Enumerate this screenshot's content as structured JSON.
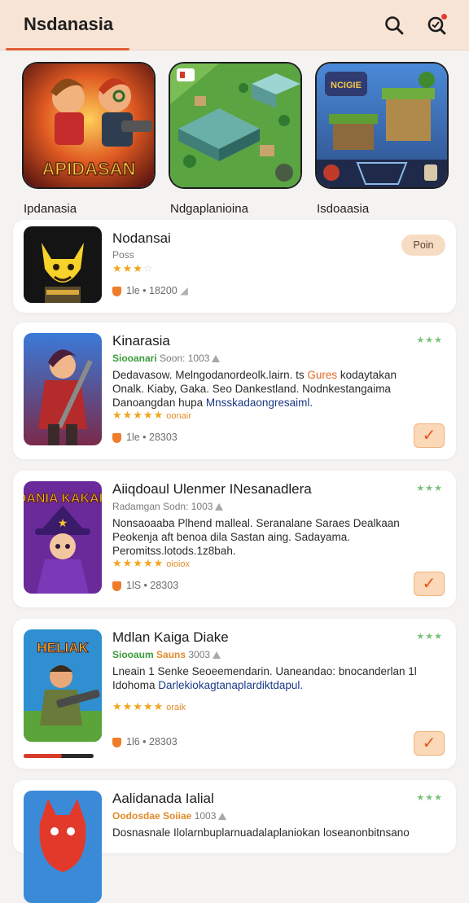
{
  "header": {
    "title": "Nsdanasia",
    "search_icon": "search-icon",
    "notif_icon": "notification-search-icon"
  },
  "featured": [
    {
      "name": "Ipdanasia",
      "art_text": "APIDASAN"
    },
    {
      "name": "Ndgaplanioina"
    },
    {
      "name": "Isdoaasia",
      "art_text": "NCIGIE"
    }
  ],
  "top_card": {
    "title": "Nodansai",
    "subtitle": "Poss",
    "stars": "★★★",
    "stars_empty": "☆",
    "stats": "1le • 18200",
    "play_label": "Poin"
  },
  "apps": [
    {
      "title": "Kinarasia",
      "meta_green": "Siooanari",
      "meta_rest": "Soon: 1003",
      "desc_lines": [
        {
          "parts": [
            {
              "t": "Dedavasow. Melngodanordeolk.lairn. ts "
            },
            {
              "t": "Gures",
              "c": "hl"
            },
            {
              "t": " kodaytakan"
            }
          ]
        },
        {
          "parts": [
            {
              "t": "Onalk. Kiaby, Gaka. Seo Dankestland. Nodnkestangaima"
            }
          ]
        },
        {
          "parts": [
            {
              "t": "Danoangdan hupa "
            },
            {
              "t": "Mnsskadaongresaiml.",
              "c": "bl"
            }
          ]
        }
      ],
      "stars": "★★★★★",
      "stars_tag": "oonair",
      "stats": "1le • 28303",
      "mini": "★★★"
    },
    {
      "title": "Aiiqdoaul Ulenmer INesanadlera",
      "meta_green": "",
      "meta_rest": "Radamgan Sodn: 1003",
      "desc_lines": [
        {
          "parts": [
            {
              "t": "Nonsaoaaba Plhend malleal. Seranalane Saraes Dealkaan"
            }
          ]
        },
        {
          "parts": [
            {
              "t": "Peokenja aft benoa dila Sastan aing. Sadayama."
            }
          ]
        },
        {
          "parts": [
            {
              "t": "Peromitss.lotods.1z8bah."
            }
          ]
        }
      ],
      "stars": "★★★★★",
      "stars_tag": "oioiox",
      "stats": "1lS • 28303",
      "mini": "★★★",
      "art_text": "DANIA KAKAR"
    },
    {
      "title": "Mdlan Kaiga Diake",
      "meta_green": "Siooaum",
      "meta_orange": "Sauns",
      "meta_rest": "3003",
      "desc_lines": [
        {
          "parts": [
            {
              "t": "Lneain 1 Senke Seoeemendarin. Uaneandao: bnocanderlan 1l"
            }
          ]
        },
        {
          "parts": [
            {
              "t": "Idohoma "
            },
            {
              "t": "Darlekiokagtanaplardiktdapul.",
              "c": "bl"
            }
          ]
        }
      ],
      "stars": "★★★★★",
      "stars_tag": "oraik",
      "stats": "1l6 • 28303",
      "mini": "★★★",
      "progress": 0.55,
      "art_text": "HELIAK"
    },
    {
      "title": "Aalidanada Ialial",
      "meta_green": "",
      "meta_orange": "Oodosdae Soiiae",
      "meta_rest": "1003",
      "desc_lines": [
        {
          "parts": [
            {
              "t": "Dosnasnale Ilolarnbuplarnuadalaplaniokan loseanonbitnsano"
            }
          ]
        }
      ],
      "mini": "★★★"
    }
  ],
  "colors": {
    "accent": "#e25d34",
    "header_bg": "#f7e4d5",
    "star": "#f2a51d"
  }
}
